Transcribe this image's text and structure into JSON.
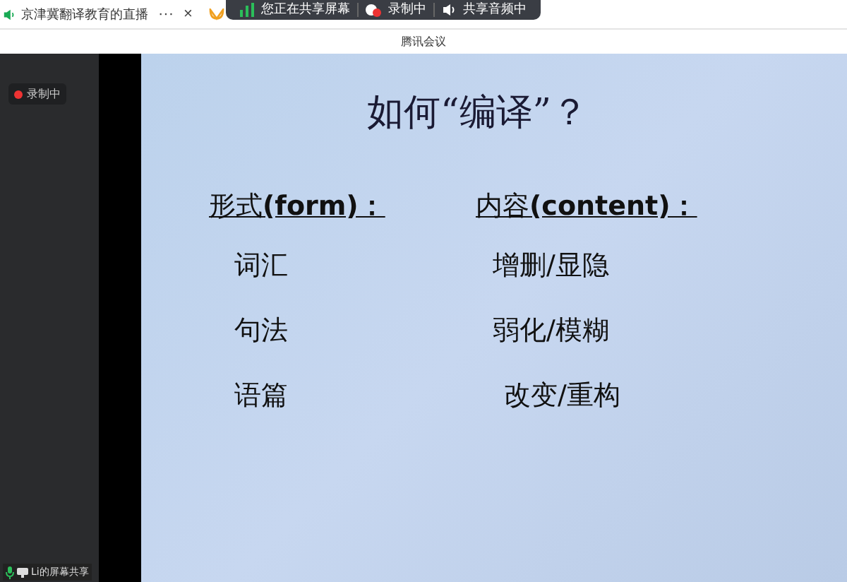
{
  "browser_tab": {
    "title": "京津冀翻译教育的直播",
    "more": "···",
    "close": "×"
  },
  "share_toolbar": {
    "items": [
      "您正在共享屏幕",
      "录制中",
      "共享音频中"
    ]
  },
  "window": {
    "title": "腾讯会议"
  },
  "sidebar": {
    "recording_badge": "录制中",
    "share_label": "Li的屏幕共享"
  },
  "slide": {
    "title": "如何“编译”？",
    "columns": [
      {
        "heading": "形式",
        "heading_en": "(form)：",
        "items": [
          "词汇",
          "句法",
          "语篇"
        ]
      },
      {
        "heading": "内容",
        "heading_en": "(content)：",
        "items": [
          "增删/显隐",
          "弱化/模糊",
          "改变/重构"
        ]
      }
    ]
  }
}
